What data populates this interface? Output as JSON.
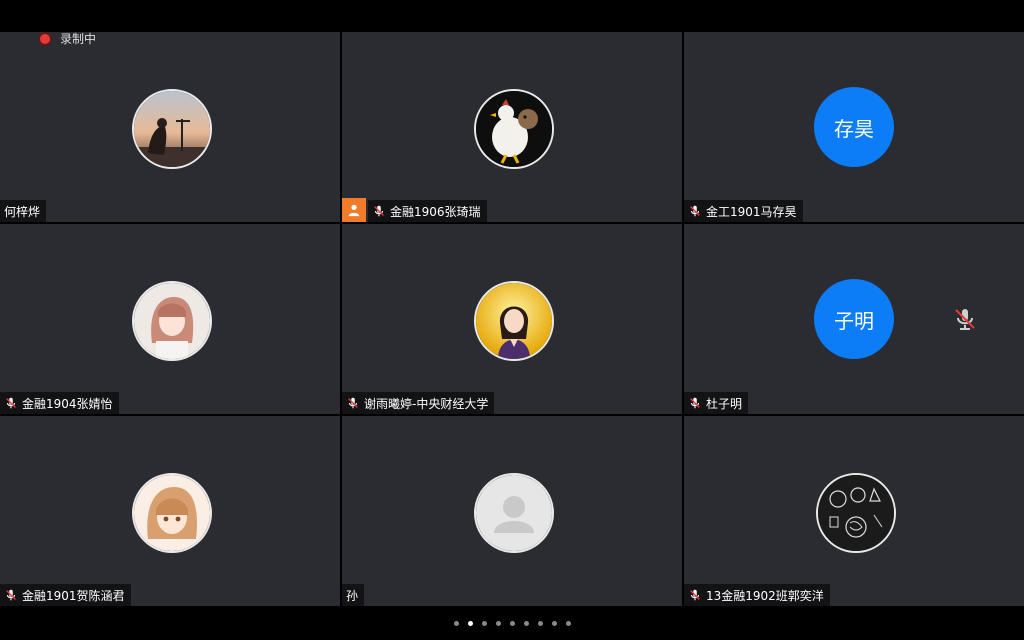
{
  "recording": {
    "label": "录制中",
    "color": "#e53935"
  },
  "accent_color": "#0d7df7",
  "host_badge_color": "#f07b2a",
  "participants": [
    {
      "name": "何梓烨",
      "mic": "none",
      "avatar": "photo-sunset"
    },
    {
      "name": "金融1906张琦瑞",
      "mic": "muted",
      "avatar": "photo-chicken",
      "host": true
    },
    {
      "name": "金工1901马存昊",
      "mic": "muted",
      "avatar": "initials",
      "initials": "存昊"
    },
    {
      "name": "金融1904张婧怡",
      "mic": "muted",
      "avatar": "photo-anime-girl"
    },
    {
      "name": "谢雨曦婷-中央财经大学",
      "mic": "muted",
      "avatar": "photo-portrait"
    },
    {
      "name": "杜子明",
      "mic": "muted",
      "avatar": "initials",
      "initials": "子明"
    },
    {
      "name": "金融1901贺陈涵君",
      "mic": "muted",
      "avatar": "photo-anime-girl-2"
    },
    {
      "name": "孙",
      "mic": "none",
      "avatar": "default-user-icon"
    },
    {
      "name": "13金融1902班郭奕洋",
      "mic": "muted",
      "avatar": "photo-sketch"
    }
  ],
  "pagination": {
    "total": 9,
    "current": 2
  }
}
